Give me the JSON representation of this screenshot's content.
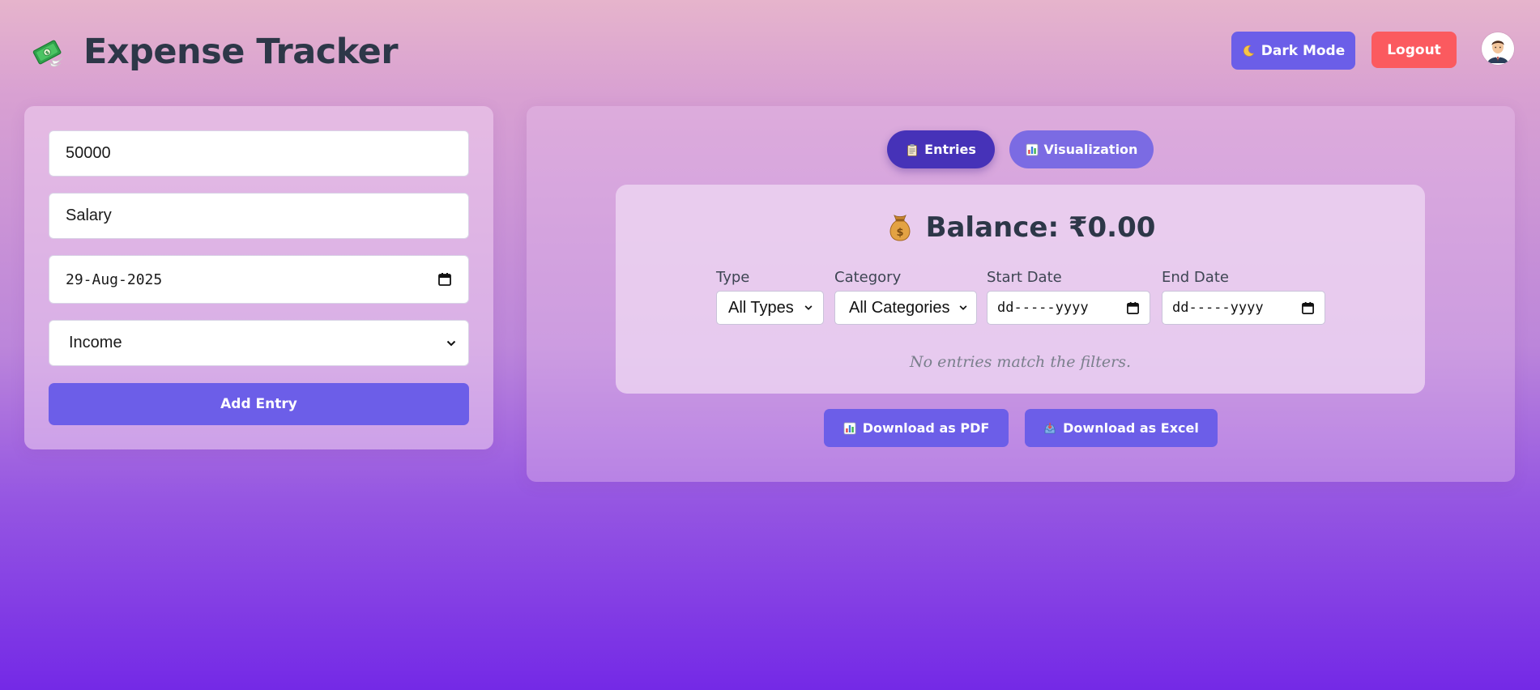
{
  "header": {
    "title": "Expense Tracker",
    "dark_mode_label": "Dark Mode",
    "logout_label": "Logout",
    "logo_icon": "money-with-wings-icon",
    "dark_mode_icon": "crescent-moon-icon",
    "avatar_icon": "user-avatar-icon"
  },
  "entry_form": {
    "amount_value": "50000",
    "description_value": "Salary",
    "date_value": "29-Aug-2025",
    "type_value": "Income",
    "add_label": "Add Entry"
  },
  "tabs": [
    {
      "label": "Entries",
      "icon": "clipboard-icon",
      "active": true
    },
    {
      "label": "Visualization",
      "icon": "bar-chart-icon",
      "active": false
    }
  ],
  "balance": {
    "icon": "money-bag-icon",
    "text": "Balance: ₹0.00"
  },
  "filters": {
    "type_label": "Type",
    "type_value": "All Types",
    "category_label": "Category",
    "category_value": "All Categories",
    "start_label": "Start Date",
    "start_placeholder": "dd-----yyyy",
    "end_label": "End Date",
    "end_placeholder": "dd-----yyyy"
  },
  "empty_message": "No entries match the filters.",
  "downloads": {
    "pdf_label": "Download as PDF",
    "excel_label": "Download as Excel",
    "pdf_icon": "bar-chart-icon",
    "excel_icon": "inbox-tray-icon"
  },
  "colors": {
    "primary": "#6c5ee8",
    "active_tab": "#4632b8",
    "logout": "#fb5a5f",
    "text": "#2d3748"
  }
}
